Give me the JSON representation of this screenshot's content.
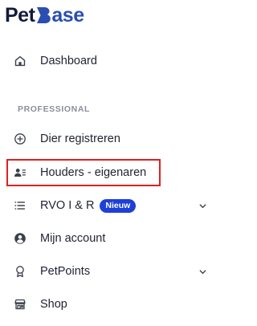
{
  "brand": {
    "part1": "Pet",
    "part2": "Base",
    "colors": {
      "dark": "#131a3c",
      "blue": "#2a4eb1"
    }
  },
  "nav": {
    "dashboard": {
      "label": "Dashboard",
      "icon": "home-icon"
    },
    "section_professional": "PROFESSIONAL",
    "dier_registreren": {
      "label": "Dier registreren",
      "icon": "plus-circle-icon"
    },
    "houders": {
      "label": "Houders - eigenaren",
      "icon": "contacts-icon"
    },
    "rvo": {
      "label": "RVO I & R",
      "icon": "list-icon",
      "badge": "Nieuw",
      "badge_color": "#1e40d6",
      "expandable": true
    },
    "account": {
      "label": "Mijn account",
      "icon": "user-circle-icon"
    },
    "petpoints": {
      "label": "PetPoints",
      "icon": "award-icon",
      "expandable": true
    },
    "shop": {
      "label": "Shop",
      "icon": "store-icon"
    }
  },
  "highlight": {
    "target": "houders",
    "color": "#e0201f"
  }
}
